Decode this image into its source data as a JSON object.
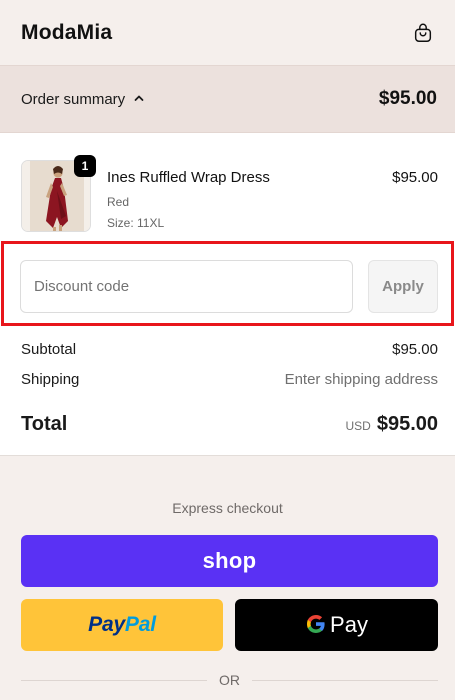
{
  "header": {
    "brand": "ModaMia",
    "cart_icon": "shopping-bag-icon"
  },
  "summary": {
    "toggle_label": "Order summary",
    "toggle_icon": "chevron-up-icon",
    "total": "$95.00"
  },
  "item": {
    "quantity": "1",
    "name": "Ines Ruffled Wrap Dress",
    "color": "Red",
    "size": "Size: 11XL",
    "price": "$95.00"
  },
  "discount": {
    "placeholder": "Discount code",
    "value": "",
    "apply_label": "Apply"
  },
  "totals": {
    "subtotal_label": "Subtotal",
    "subtotal_value": "$95.00",
    "shipping_label": "Shipping",
    "shipping_value": "Enter shipping address",
    "total_label": "Total",
    "currency": "USD",
    "total_value": "$95.00"
  },
  "express": {
    "label": "Express checkout",
    "shop_label": "shop",
    "paypal_label_a": "Pay",
    "paypal_label_b": "Pal",
    "gpay_label": "Pay",
    "or_label": "OR"
  },
  "colors": {
    "page_bg": "#f5efec",
    "summary_bg": "#ece1dd",
    "highlight": "#e8161b",
    "shop_pay": "#5a31f4",
    "paypal": "#ffc439",
    "gpay": "#000000"
  }
}
